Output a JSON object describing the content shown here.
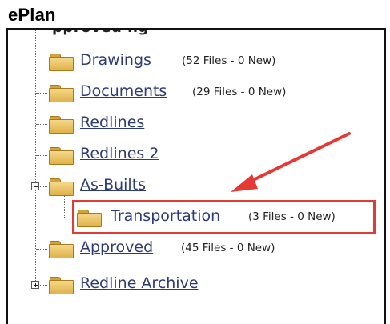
{
  "header": {
    "title": "ePlan"
  },
  "tree": {
    "clipped_label": "pproved ng",
    "items": [
      {
        "label": "Drawings",
        "count": "(52 Files - 0 New)"
      },
      {
        "label": "Documents",
        "count": "(29 Files - 0 New)"
      },
      {
        "label": "Redlines",
        "count": ""
      },
      {
        "label": "Redlines 2",
        "count": ""
      },
      {
        "label": "As-Builts",
        "count": "",
        "expanded": true
      },
      {
        "label": "Transportation",
        "count": "(3 Files - 0 New)",
        "highlighted": true
      },
      {
        "label": "Approved",
        "count": "(45 Files - 0 New)"
      },
      {
        "label": "Redline Archive",
        "count": "",
        "collapsed": true
      }
    ]
  },
  "annotation": {
    "color": "#e53935"
  },
  "icons": {
    "folder": "folder-icon",
    "expand": "plus-icon",
    "collapse": "minus-icon"
  }
}
